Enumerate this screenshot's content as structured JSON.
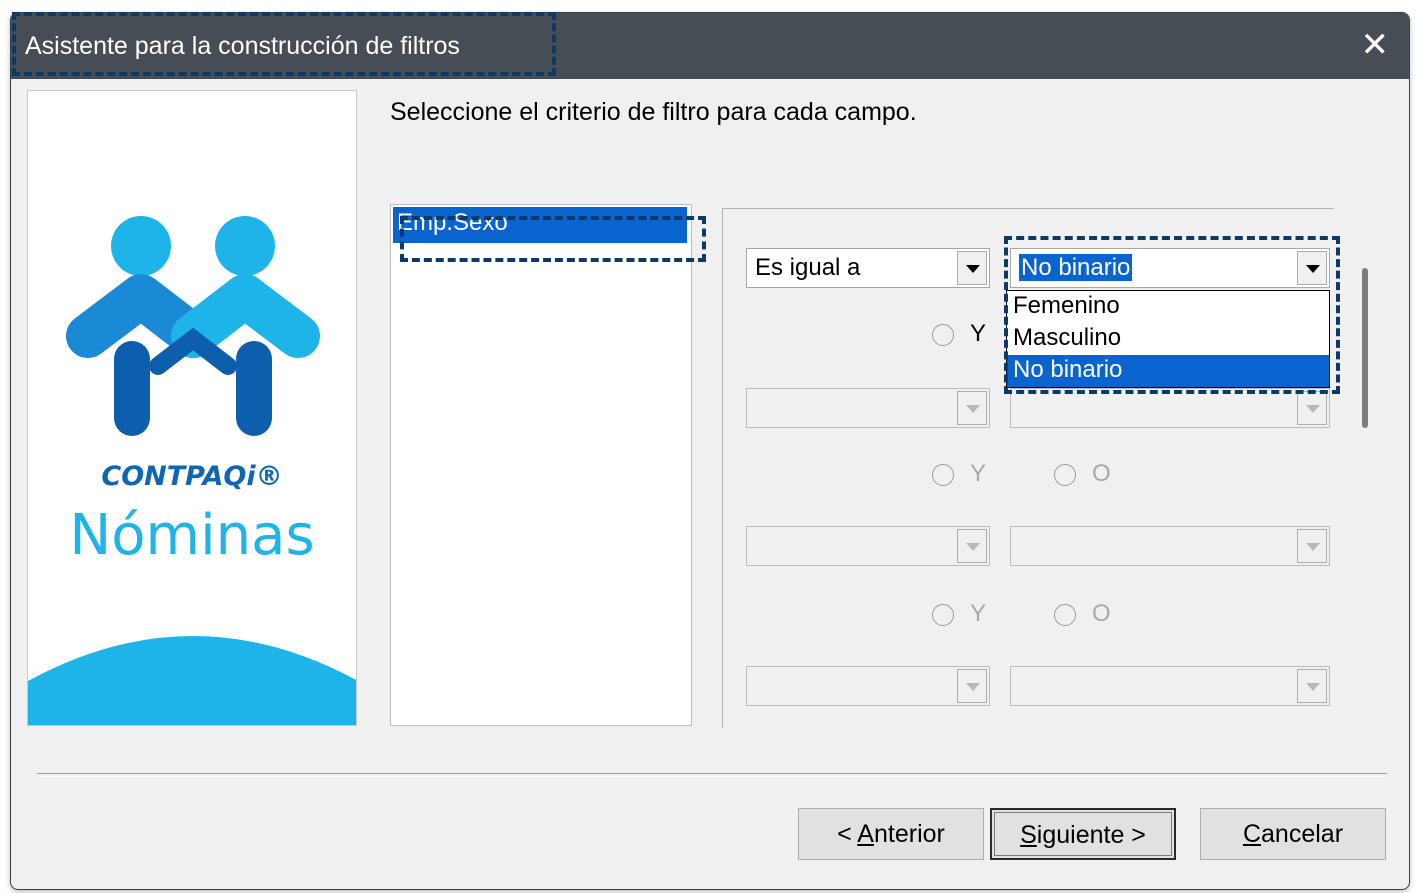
{
  "window": {
    "title": "Asistente para la construcción de filtros",
    "close_icon": "close-icon"
  },
  "logo": {
    "brand": "CONTPAQi®",
    "product": "Nóminas",
    "colors": {
      "light_blue": "#1eb4ea",
      "mid_blue": "#1b8ad6",
      "dark_blue": "#0d5fae"
    }
  },
  "instruction": "Seleccione el criterio de filtro para cada campo.",
  "fields": {
    "items": [
      "Emp.Sexo"
    ],
    "selected": "Emp.Sexo"
  },
  "criteria": {
    "row1": {
      "operator": "Es igual a",
      "value": "No binario"
    },
    "connector1": {
      "y_label": "Y"
    },
    "connector2": {
      "y_label": "Y",
      "o_label": "O"
    },
    "connector3": {
      "y_label": "Y",
      "o_label": "O"
    }
  },
  "dropdown": {
    "options": [
      "Femenino",
      "Masculino",
      "No binario"
    ],
    "selected": "No binario"
  },
  "buttons": {
    "back": {
      "prefix": "< ",
      "mnemonic": "A",
      "rest": "nterior"
    },
    "next": {
      "mnemonic": "S",
      "rest": "iguiente >"
    },
    "cancel": {
      "mnemonic": "C",
      "rest": "ancelar"
    }
  },
  "colors": {
    "titlebar": "#474d54",
    "selection": "#0a64d0",
    "highlight_border": "#0c3a67"
  }
}
